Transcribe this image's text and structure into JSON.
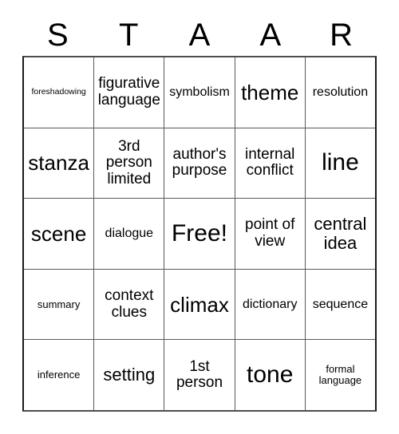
{
  "card": {
    "title_letters": [
      "S",
      "T",
      "A",
      "A",
      "R"
    ],
    "columns": 5,
    "rows": 5,
    "free_space_label": "Free!",
    "free_space_position": "row3-col3",
    "colors": {
      "text": "#000000",
      "cell_background": "#ffffff",
      "grid_line": "#595959",
      "outer_border": "#1a1a1a",
      "page_background": "#ffffff"
    },
    "grid": [
      [
        {
          "label": "foreshadowing",
          "size": "xxs",
          "free": false
        },
        {
          "label": "figurative language",
          "size": "md",
          "free": false
        },
        {
          "label": "symbolism",
          "size": "sm",
          "free": false
        },
        {
          "label": "theme",
          "size": "xl",
          "free": false
        },
        {
          "label": "resolution",
          "size": "sm",
          "free": false
        }
      ],
      [
        {
          "label": "stanza",
          "size": "xl",
          "free": false
        },
        {
          "label": "3rd person limited",
          "size": "md",
          "free": false
        },
        {
          "label": "author's purpose",
          "size": "md",
          "free": false
        },
        {
          "label": "internal conflict",
          "size": "md",
          "free": false
        },
        {
          "label": "line",
          "size": "xxl",
          "free": false
        }
      ],
      [
        {
          "label": "scene",
          "size": "xl",
          "free": false
        },
        {
          "label": "dialogue",
          "size": "sm",
          "free": false
        },
        {
          "label": "Free!",
          "size": "xxl",
          "free": true
        },
        {
          "label": "point of view",
          "size": "md",
          "free": false
        },
        {
          "label": "central idea",
          "size": "lg",
          "free": false
        }
      ],
      [
        {
          "label": "summary",
          "size": "xs",
          "free": false
        },
        {
          "label": "context clues",
          "size": "md",
          "free": false
        },
        {
          "label": "climax",
          "size": "xl",
          "free": false
        },
        {
          "label": "dictionary",
          "size": "sm",
          "free": false
        },
        {
          "label": "sequence",
          "size": "sm",
          "free": false
        }
      ],
      [
        {
          "label": "inference",
          "size": "xs",
          "free": false
        },
        {
          "label": "setting",
          "size": "lg",
          "free": false
        },
        {
          "label": "1st person",
          "size": "md",
          "free": false
        },
        {
          "label": "tone",
          "size": "xxl",
          "free": false
        },
        {
          "label": "formal language",
          "size": "xs",
          "free": false
        }
      ]
    ]
  }
}
